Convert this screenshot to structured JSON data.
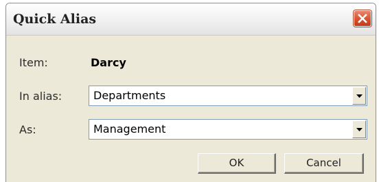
{
  "window": {
    "title": "Quick Alias"
  },
  "form": {
    "item_label": "Item:",
    "item_value": "Darcy",
    "alias_label": "In alias:",
    "alias_value": "Departments",
    "as_label": "As:",
    "as_value": "Management"
  },
  "buttons": {
    "ok_label": "OK",
    "cancel_label": "Cancel"
  },
  "icons": {
    "close": "close-icon",
    "dropdown": "chevron-down-icon"
  },
  "colors": {
    "close_button": "#d6532f",
    "dialog_background": "#ece9d8",
    "field_border": "#7f9db9"
  }
}
